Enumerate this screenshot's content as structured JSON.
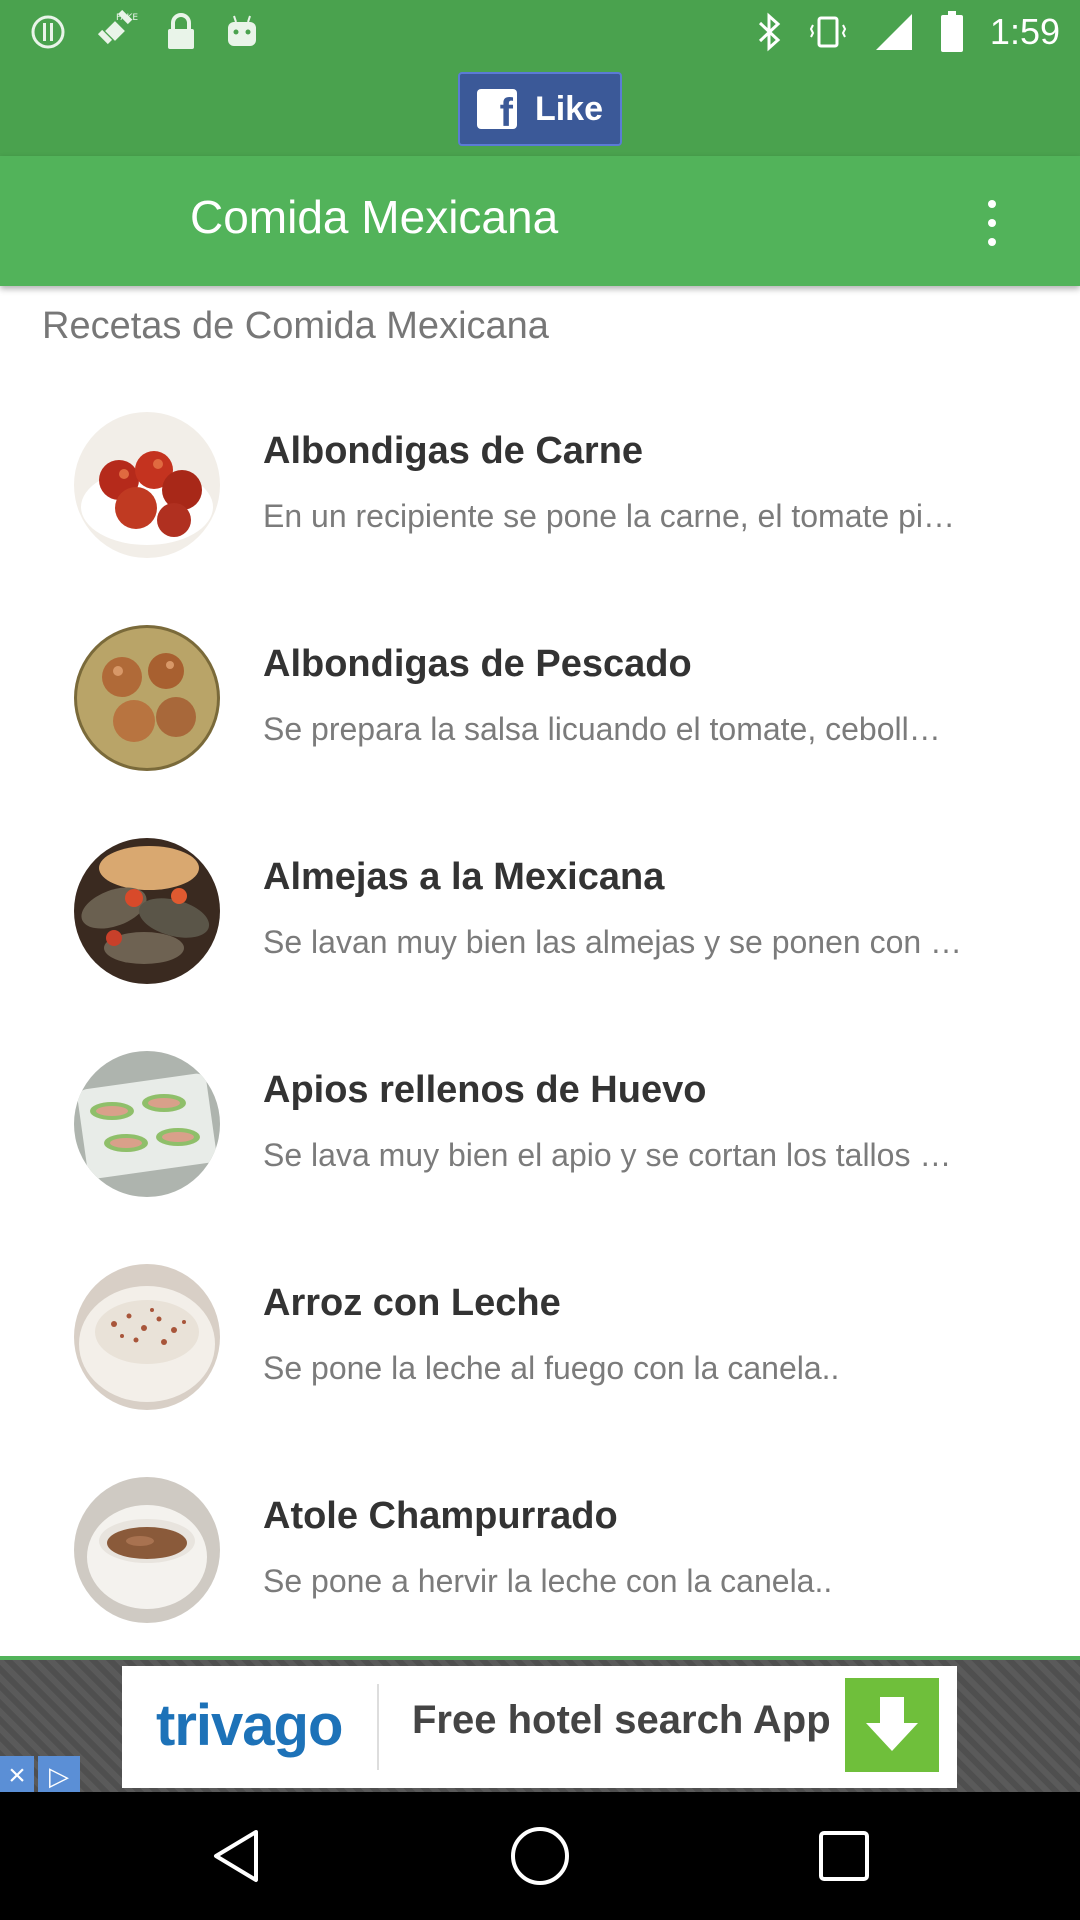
{
  "status_bar": {
    "time": "1:59",
    "left_icons": [
      "alert-icon",
      "fake-gps-icon",
      "lock-icon",
      "android-icon"
    ],
    "right_icons": [
      "bluetooth-icon",
      "vibrate-icon",
      "signal-icon",
      "battery-icon"
    ]
  },
  "facebook": {
    "like_label": "Like",
    "icon": "facebook-icon"
  },
  "appbar": {
    "title": "Comida Mexicana",
    "menu_icon": "more-vert-icon"
  },
  "section_title": "Recetas de Comida Mexicana",
  "recipes": [
    {
      "title": "Albondigas de Carne",
      "description": "En un recipiente se pone la carne, el tomate pi…"
    },
    {
      "title": "Albondigas de Pescado",
      "description": "Se prepara la salsa licuando el tomate, ceboll…"
    },
    {
      "title": "Almejas a la Mexicana",
      "description": "Se lavan muy bien las almejas y se ponen con …"
    },
    {
      "title": "Apios rellenos de Huevo",
      "description": "Se lava muy bien el apio y se cortan los tallos …"
    },
    {
      "title": "Arroz con Leche",
      "description": "Se pone la leche al fuego con la canela.."
    },
    {
      "title": "Atole Champurrado",
      "description": "Se pone a hervir la leche con la canela.."
    }
  ],
  "ad": {
    "brand": "trivago",
    "text": "Free hotel search App",
    "close": "×",
    "info": "▷"
  },
  "colors": {
    "status_green": "#4aa24e",
    "appbar_green": "#52b35a",
    "facebook_blue": "#3b5998"
  }
}
